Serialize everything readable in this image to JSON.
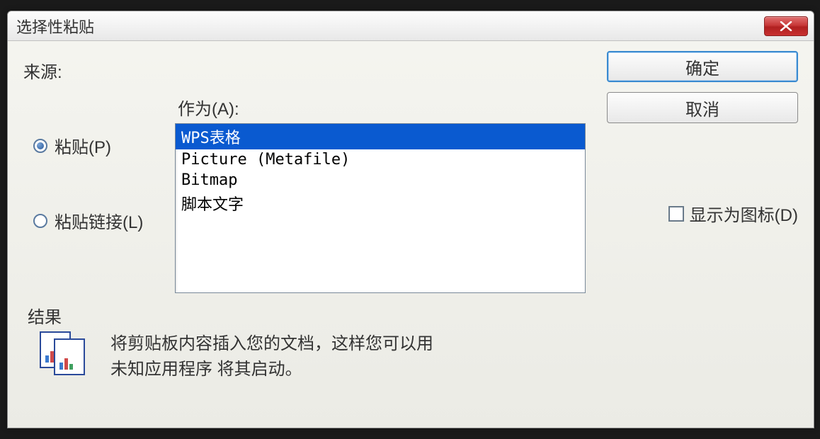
{
  "dialog": {
    "title": "选择性粘贴",
    "source_label": "来源:",
    "as_label": "作为(A):",
    "paste_radio": "粘贴(P)",
    "paste_link_radio": "粘贴链接(L)",
    "list_items": [
      "WPS表格",
      "Picture (Metafile)",
      "Bitmap",
      "脚本文字"
    ],
    "selected_index": 0,
    "ok_button": "确定",
    "cancel_button": "取消",
    "display_as_icon": "显示为图标(D)",
    "result_label": "结果",
    "result_text_line1": "将剪贴板内容插入您的文档，这样您可以用",
    "result_text_line2": "未知应用程序 将其启动。"
  }
}
